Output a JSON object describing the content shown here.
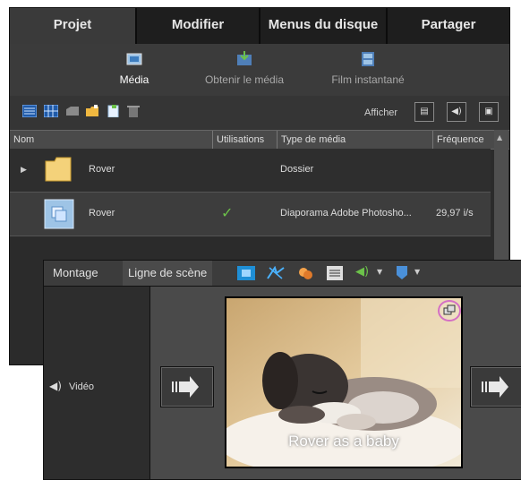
{
  "tabs": [
    "Projet",
    "Modifier",
    "Menus du disque",
    "Partager"
  ],
  "subtabs": [
    "Média",
    "Obtenir le média",
    "Film instantané"
  ],
  "toolbar": {
    "afficher_label": "Afficher"
  },
  "table": {
    "headers": [
      "Nom",
      "Utilisations",
      "Type de média",
      "Fréquence"
    ],
    "rows": [
      {
        "name": "Rover",
        "uses": "",
        "type": "Dossier",
        "freq": "",
        "icon": "folder-icon"
      },
      {
        "name": "Rover",
        "uses": "✓",
        "type": "Diaporama Adobe Photosho...",
        "freq": "29,97 i/s",
        "icon": "slideshow-icon"
      }
    ]
  },
  "timeline": {
    "tabs": [
      "Montage",
      "Ligne de scène"
    ],
    "track_label": "Vidéo",
    "caption": "Rover as a baby"
  },
  "colors": {
    "accent_pink": "#d46fc4",
    "check_green": "#6cc24a",
    "blue_icon": "#4a90d9"
  }
}
